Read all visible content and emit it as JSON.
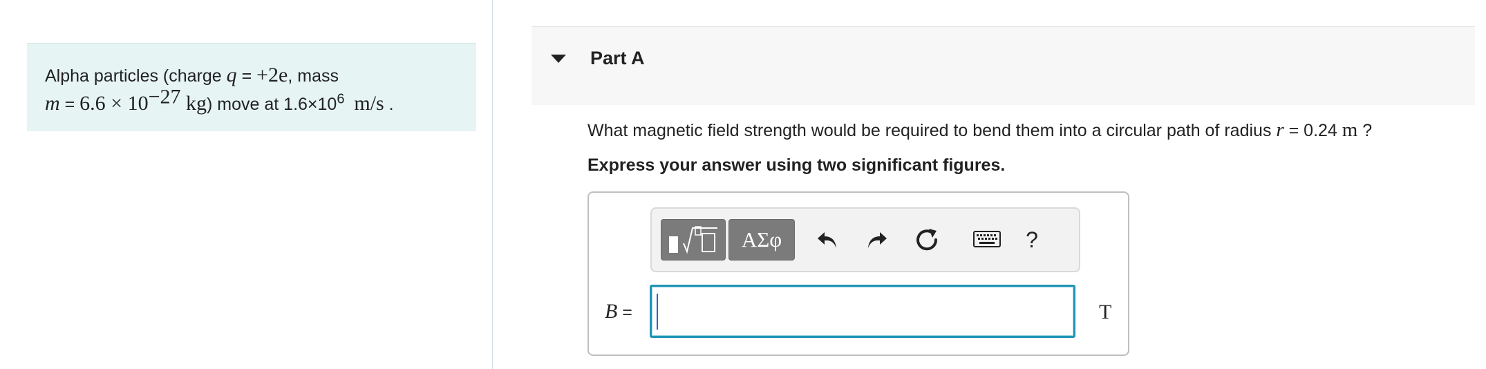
{
  "intro": {
    "text_1": "Alpha particles (charge ",
    "q_var": "q",
    "eq1": " = ",
    "q_value": "+2e",
    "text_2": ", mass",
    "m_var": "m",
    "eq2": " = ",
    "mass_mantissa": "6.6 × 10",
    "mass_exponent": "−27",
    "mass_unit": " kg",
    "text_3": ") move at 1.6×10",
    "speed_exponent": "6",
    "speed_unit": "m/s",
    "period": " ."
  },
  "part": {
    "title": "Part A",
    "question_text": "What magnetic field strength would be required to bend them into a circular path of radius ",
    "r_var": "r",
    "r_eq": " = 0.24 ",
    "r_unit": "m",
    "question_end": " ?",
    "instruction": "Express your answer using two significant figures."
  },
  "toolbar": {
    "templates_icon": "templates-sqrt-icon",
    "greek_label": "ΑΣφ",
    "undo_icon": "undo-icon",
    "redo_icon": "redo-icon",
    "reset_icon": "reset-icon",
    "keyboard_icon": "keyboard-icon",
    "help_label": "?"
  },
  "answer": {
    "variable": "B",
    "equals": " =",
    "value": "",
    "unit": "T"
  },
  "colors": {
    "intro_bg": "#e6f4f4",
    "header_bg": "#f7f7f7",
    "input_border": "#1f94b5",
    "toolbar_dark": "#7b7b7b"
  }
}
